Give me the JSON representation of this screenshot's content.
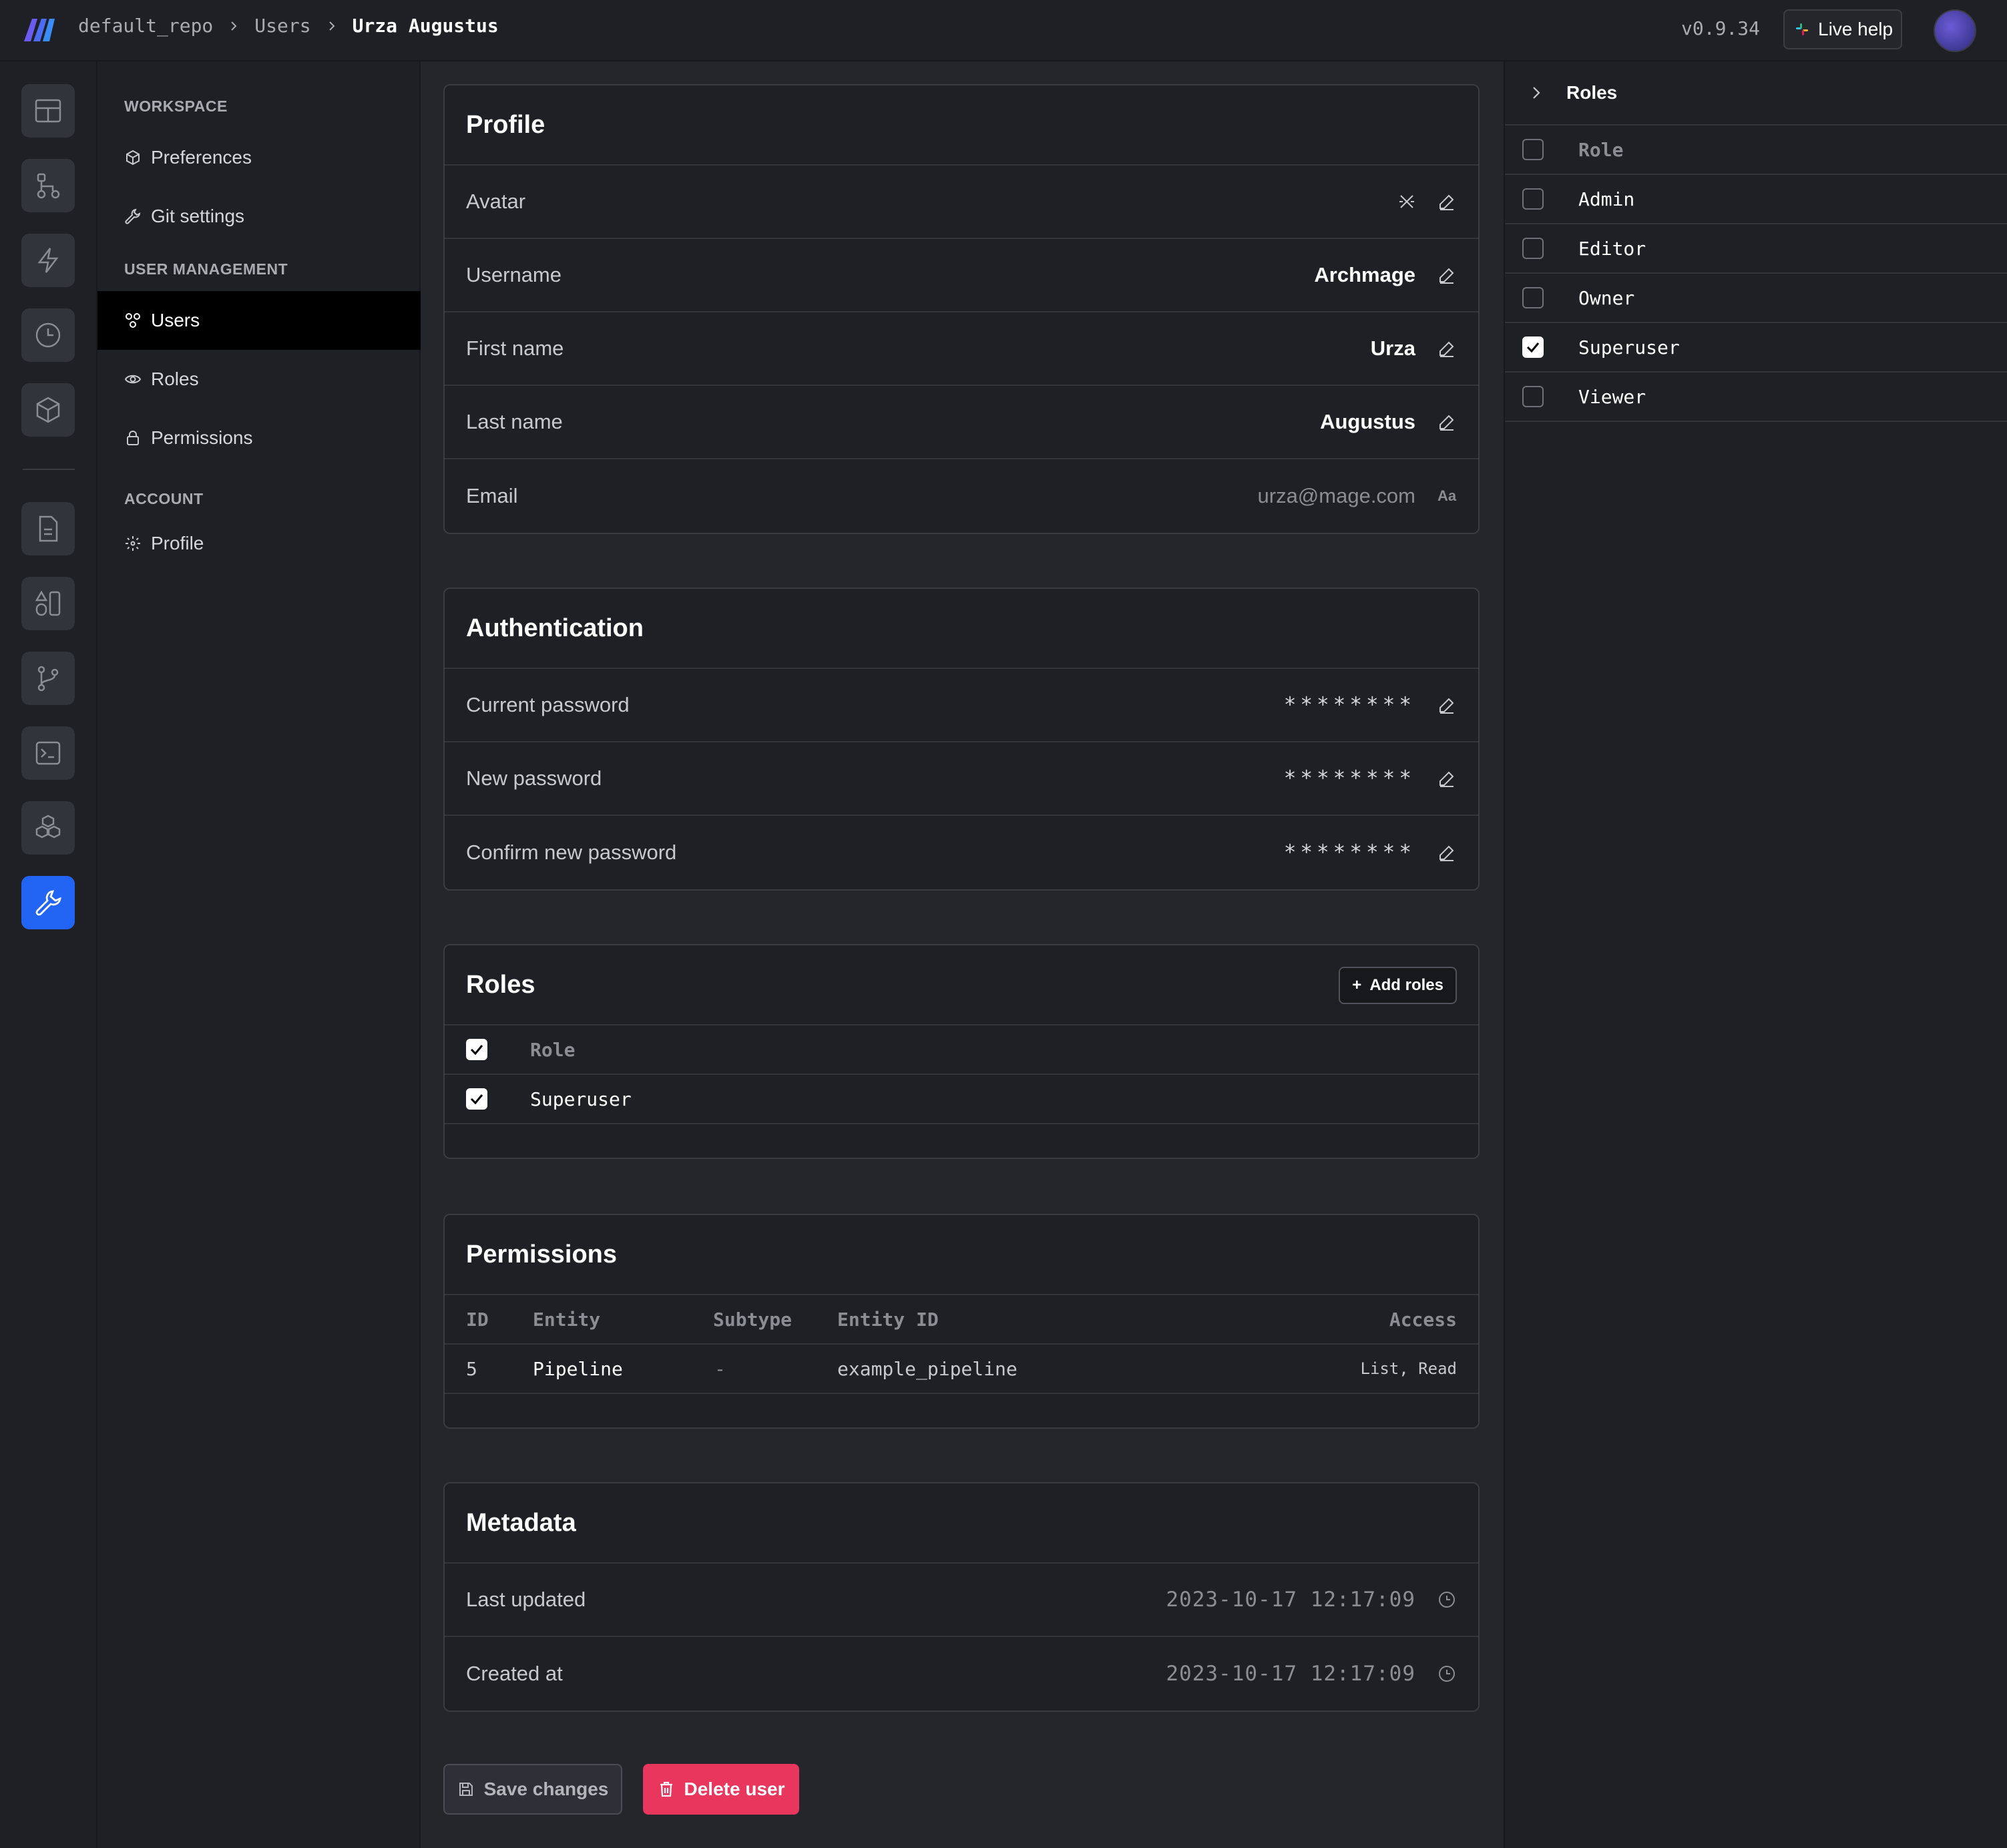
{
  "breadcrumb": [
    "default_repo",
    "Users",
    "Urza Augustus"
  ],
  "version": "v0.9.34",
  "live_help_label": "Live help",
  "sidebar": {
    "sections": [
      "WORKSPACE",
      "USER MANAGEMENT",
      "ACCOUNT"
    ],
    "items": [
      {
        "label": "Preferences"
      },
      {
        "label": "Git settings"
      },
      {
        "label": "Users"
      },
      {
        "label": "Roles"
      },
      {
        "label": "Permissions"
      },
      {
        "label": "Profile"
      }
    ],
    "active": "Users"
  },
  "profile": {
    "title": "Profile",
    "rows": [
      {
        "label": "Avatar",
        "value": ""
      },
      {
        "label": "Username",
        "value": "Archmage"
      },
      {
        "label": "First name",
        "value": "Urza"
      },
      {
        "label": "Last name",
        "value": "Augustus"
      },
      {
        "label": "Email",
        "value": "urza@mage.com",
        "suffix": "Aa"
      }
    ]
  },
  "authentication": {
    "title": "Authentication",
    "rows": [
      {
        "label": "Current password",
        "value": "********"
      },
      {
        "label": "New password",
        "value": "********"
      },
      {
        "label": "Confirm new password",
        "value": "********"
      }
    ]
  },
  "roles": {
    "title": "Roles",
    "add_label": "Add roles",
    "header": "Role",
    "items": [
      {
        "name": "Superuser",
        "checked": true
      }
    ]
  },
  "permissions": {
    "title": "Permissions",
    "columns": [
      "ID",
      "Entity",
      "Subtype",
      "Entity ID",
      "Access"
    ],
    "rows": [
      {
        "id": "5",
        "entity": "Pipeline",
        "subtype": "-",
        "entity_id": "example_pipeline",
        "access": "List, Read"
      }
    ]
  },
  "metadata": {
    "title": "Metadata",
    "rows": [
      {
        "label": "Last updated",
        "value": "2023-10-17 12:17:09"
      },
      {
        "label": "Created at",
        "value": "2023-10-17 12:17:09"
      }
    ]
  },
  "actions": {
    "save_label": "Save changes",
    "delete_label": "Delete user"
  },
  "roles_panel": {
    "title": "Roles",
    "header": "Role",
    "items": [
      {
        "name": "Admin",
        "checked": false
      },
      {
        "name": "Editor",
        "checked": false
      },
      {
        "name": "Owner",
        "checked": false
      },
      {
        "name": "Superuser",
        "checked": true
      },
      {
        "name": "Viewer",
        "checked": false
      }
    ]
  },
  "colors": {
    "accent": "#2265f5",
    "danger": "#e8365d",
    "background": "#1f2025"
  }
}
